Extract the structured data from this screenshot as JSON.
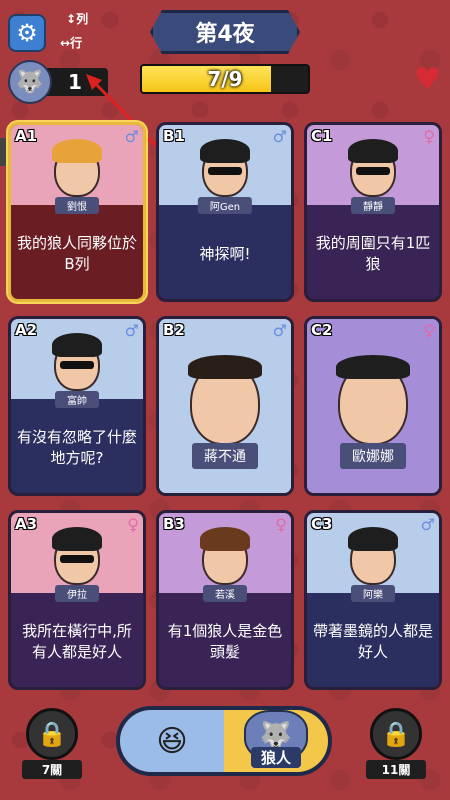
{
  "header": {
    "settings_icon": "gear-icon",
    "axis_legend": {
      "column": "列",
      "row": "行"
    },
    "night_title": "第4夜",
    "progress": {
      "text": "7/9",
      "current": 7,
      "total": 9
    },
    "wolf_count": "1",
    "heart_icon": "heart-icon"
  },
  "cards": [
    {
      "coord": "A1",
      "name": "劉恨",
      "gender": "male",
      "clue": "我的狼人同夥位於B列",
      "portrait_bg": "pink",
      "clue_bg": "dark-red",
      "hair": "#e8a23a",
      "glasses": false,
      "selected": true
    },
    {
      "coord": "B1",
      "name": "阿Gen",
      "gender": "male",
      "clue": "神探啊!",
      "portrait_bg": "blue",
      "clue_bg": "navy",
      "hair": "#1e1e1e",
      "glasses": true
    },
    {
      "coord": "C1",
      "name": "靜靜",
      "gender": "female",
      "clue": "我的周圍只有1匹狼",
      "portrait_bg": "purple",
      "clue_bg": "purple",
      "hair": "#1e1e1e",
      "glasses": true
    },
    {
      "coord": "A2",
      "name": "富帥",
      "gender": "male",
      "clue": "有沒有忽略了什麼地方呢?",
      "portrait_bg": "blue",
      "clue_bg": "navy",
      "hair": "#1e1e1e",
      "glasses": true
    },
    {
      "coord": "B2",
      "name": "蔣不通",
      "gender": "male",
      "clue": "",
      "portrait_bg": "blue",
      "clue_bg": "blue",
      "hair": "#2a1e18",
      "glasses": false,
      "revealed": true
    },
    {
      "coord": "C2",
      "name": "歐娜娜",
      "gender": "female",
      "clue": "",
      "portrait_bg": "violet",
      "clue_bg": "violet",
      "hair": "#1e1e1e",
      "glasses": false,
      "revealed": true
    },
    {
      "coord": "A3",
      "name": "伊拉",
      "gender": "female",
      "clue": "我所在橫行中,所有人都是好人",
      "portrait_bg": "pink",
      "clue_bg": "purple",
      "hair": "#1e1e1e",
      "glasses": true
    },
    {
      "coord": "B3",
      "name": "若溪",
      "gender": "female",
      "clue": "有1個狼人是金色頭髮",
      "portrait_bg": "purple",
      "clue_bg": "purple",
      "hair": "#6a3a1e",
      "glasses": false
    },
    {
      "coord": "C3",
      "name": "阿樂",
      "gender": "male",
      "clue": "帶著墨鏡的人都是好人",
      "portrait_bg": "blue",
      "clue_bg": "navy",
      "hair": "#1e1e1e",
      "glasses": false
    }
  ],
  "bottom": {
    "left_lock": {
      "icon": "lock-icon",
      "label": "7關"
    },
    "right_lock": {
      "icon": "lock-icon",
      "label": "11關"
    },
    "toggle": {
      "good_icon": "laughing-face-icon",
      "wolf_label": "狼人",
      "selected": "wolf"
    }
  },
  "colors": {
    "background": "#a83a3e",
    "accent_gold": "#f3c74a",
    "progress_fill": "#f5c417"
  }
}
